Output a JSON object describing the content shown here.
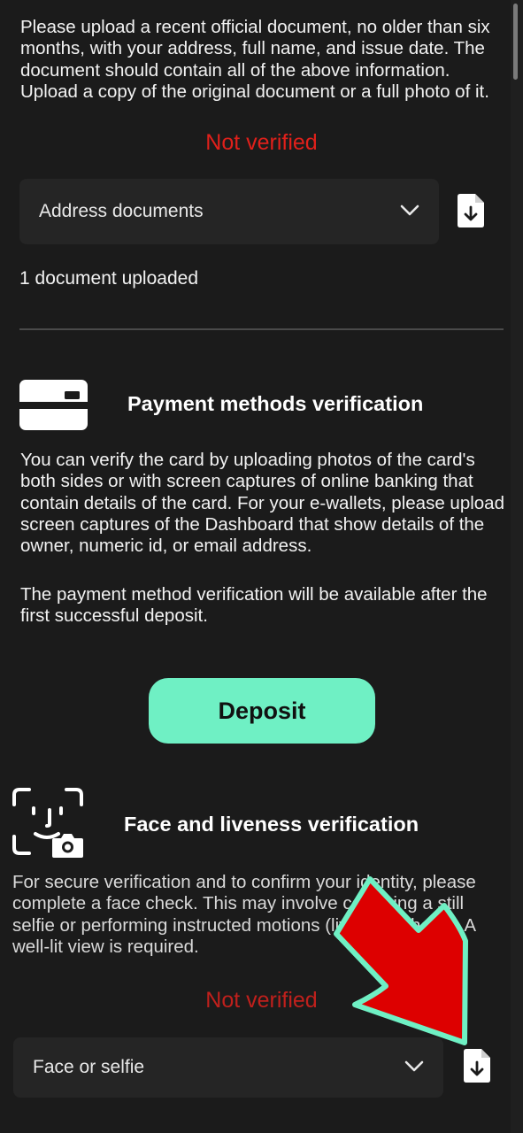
{
  "address_section": {
    "description": "Please upload a recent official document, no older than six months, with your address, full name, and issue date. The document should contain all of the above information. Upload a copy of the original document or a full photo of it.",
    "status": "Not verified",
    "select_value": "Address documents",
    "uploaded_text": "1 document uploaded"
  },
  "payment_section": {
    "title": "Payment methods verification",
    "description": "You can verify the card by uploading photos of the card's both sides or with screen captures of online banking that contain details of the card. For your e-wallets, please upload screen captures of the Dashboard that show details of the owner, numeric id, or email address.",
    "note": "The payment method verification will be available after the first successful deposit.",
    "deposit_label": "Deposit"
  },
  "face_section": {
    "title": "Face and liveness verification",
    "description": "For secure verification and to confirm your identity, please complete a face check. This may involve capturing a still selfie or performing instructed motions (liveness check). A well-lit view is required.",
    "status": "Not verified",
    "select_value": "Face or selfie"
  },
  "colors": {
    "background": "#1b1b1b",
    "status_red": "#e0201b",
    "accent": "#6ff0c4",
    "arrow_red": "#dd0000",
    "arrow_outline": "#6ff0c4"
  },
  "icons": [
    "card-icon",
    "face-scan-icon",
    "camera-icon",
    "chevron-down-icon",
    "file-download-icon",
    "annotation-arrow"
  ]
}
